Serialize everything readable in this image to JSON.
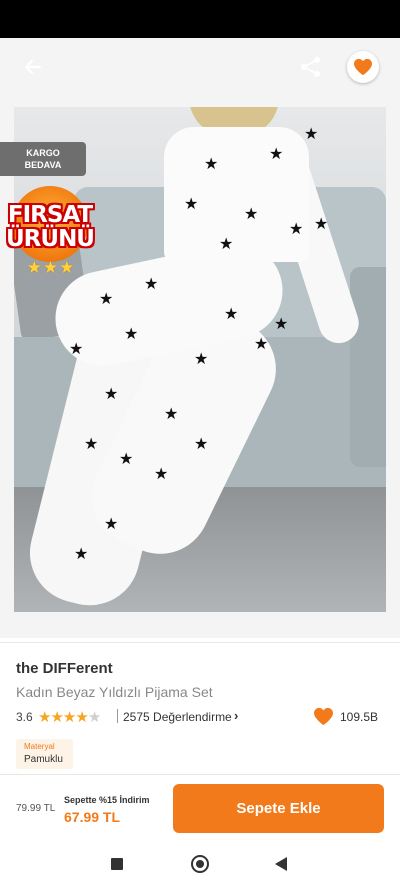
{
  "header": {
    "back_icon": "arrow-left-icon",
    "share_icon": "share-icon",
    "favorite_icon": "heart-icon"
  },
  "badges": {
    "cargo_line1": "KARGO",
    "cargo_line2": "BEDAVA",
    "firsat_line1": "FIRSAT",
    "firsat_line2": "ÜRÜNÜ",
    "firsat_stars": "★★★"
  },
  "gallery": {
    "page_count": 3,
    "active_page": 1
  },
  "product": {
    "brand": "the DIFFerent",
    "name": "Kadın Beyaz Yıldızlı Pijama Set",
    "rating": "3.6",
    "rating_value": 3.6,
    "reviews": "2575 Değerlendirme",
    "favorites": "109.5B"
  },
  "material": {
    "label": "Materyal",
    "value": "Pamuklu"
  },
  "purchase": {
    "old_price": "79.99 TL",
    "discount_label": "Sepette %15 İndirim",
    "new_price": "67.99 TL",
    "add_to_cart": "Sepete Ekle"
  },
  "colors": {
    "accent": "#f27a1a",
    "badge_gray": "#6e6e6e"
  }
}
